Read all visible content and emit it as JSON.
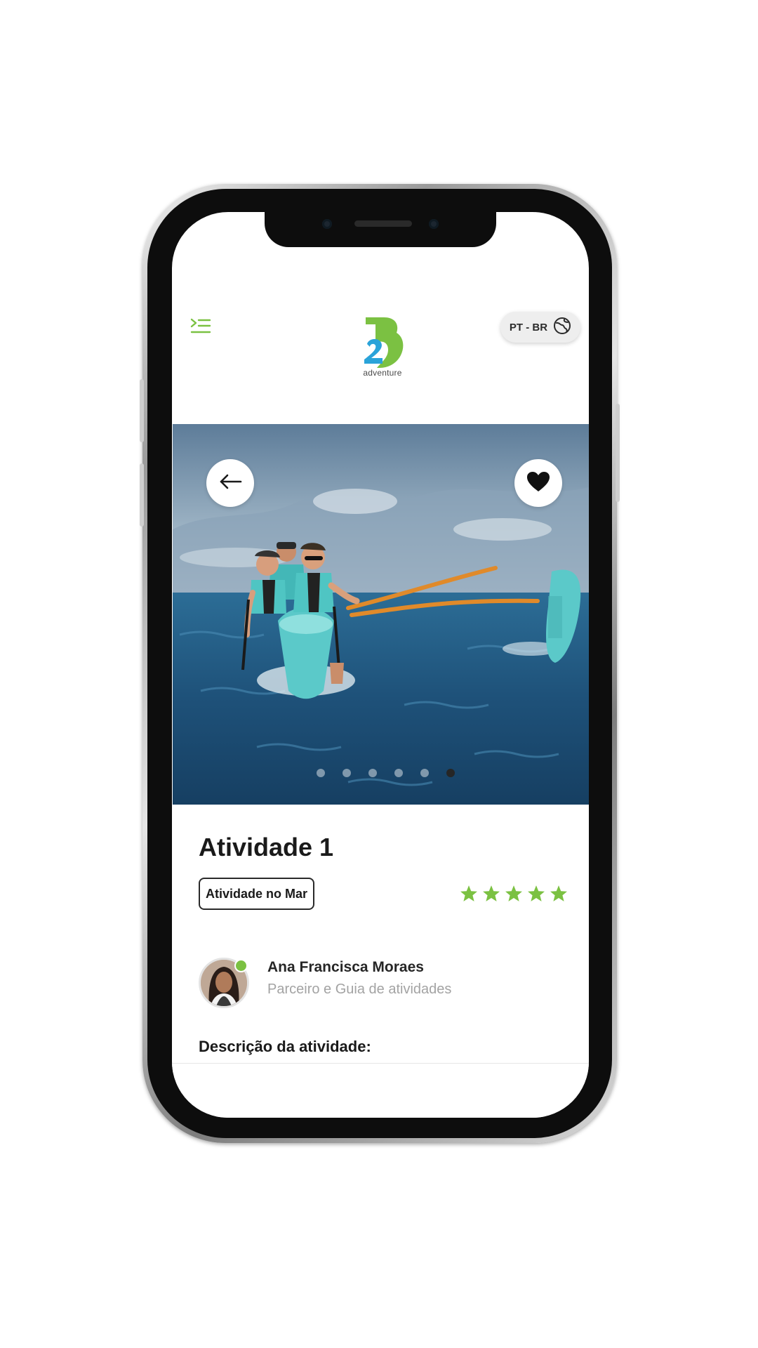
{
  "header": {
    "logo_text": "adventure",
    "language_label": "PT - BR"
  },
  "hero": {
    "image_alt": "",
    "slide_count": 6,
    "active_slide": 6
  },
  "activity": {
    "title": "Atividade 1",
    "category_tag": "Atividade no Mar",
    "rating": 5,
    "rating_max": 5
  },
  "guide": {
    "name": "Ana Francisca Moraes",
    "role": "Parceiro e Guia de atividades",
    "online": true
  },
  "description": {
    "heading": "Descrição da atividade:"
  },
  "colors": {
    "brand_green": "#7bc142",
    "brand_blue": "#2aa3d9",
    "text_dark": "#1a1a1a",
    "text_muted": "#a3a3a3"
  },
  "icons": {
    "menu": "menu-icon",
    "language": "globe-icon",
    "back": "arrow-left-icon",
    "favorite": "heart-icon",
    "rating": "star-icon"
  }
}
